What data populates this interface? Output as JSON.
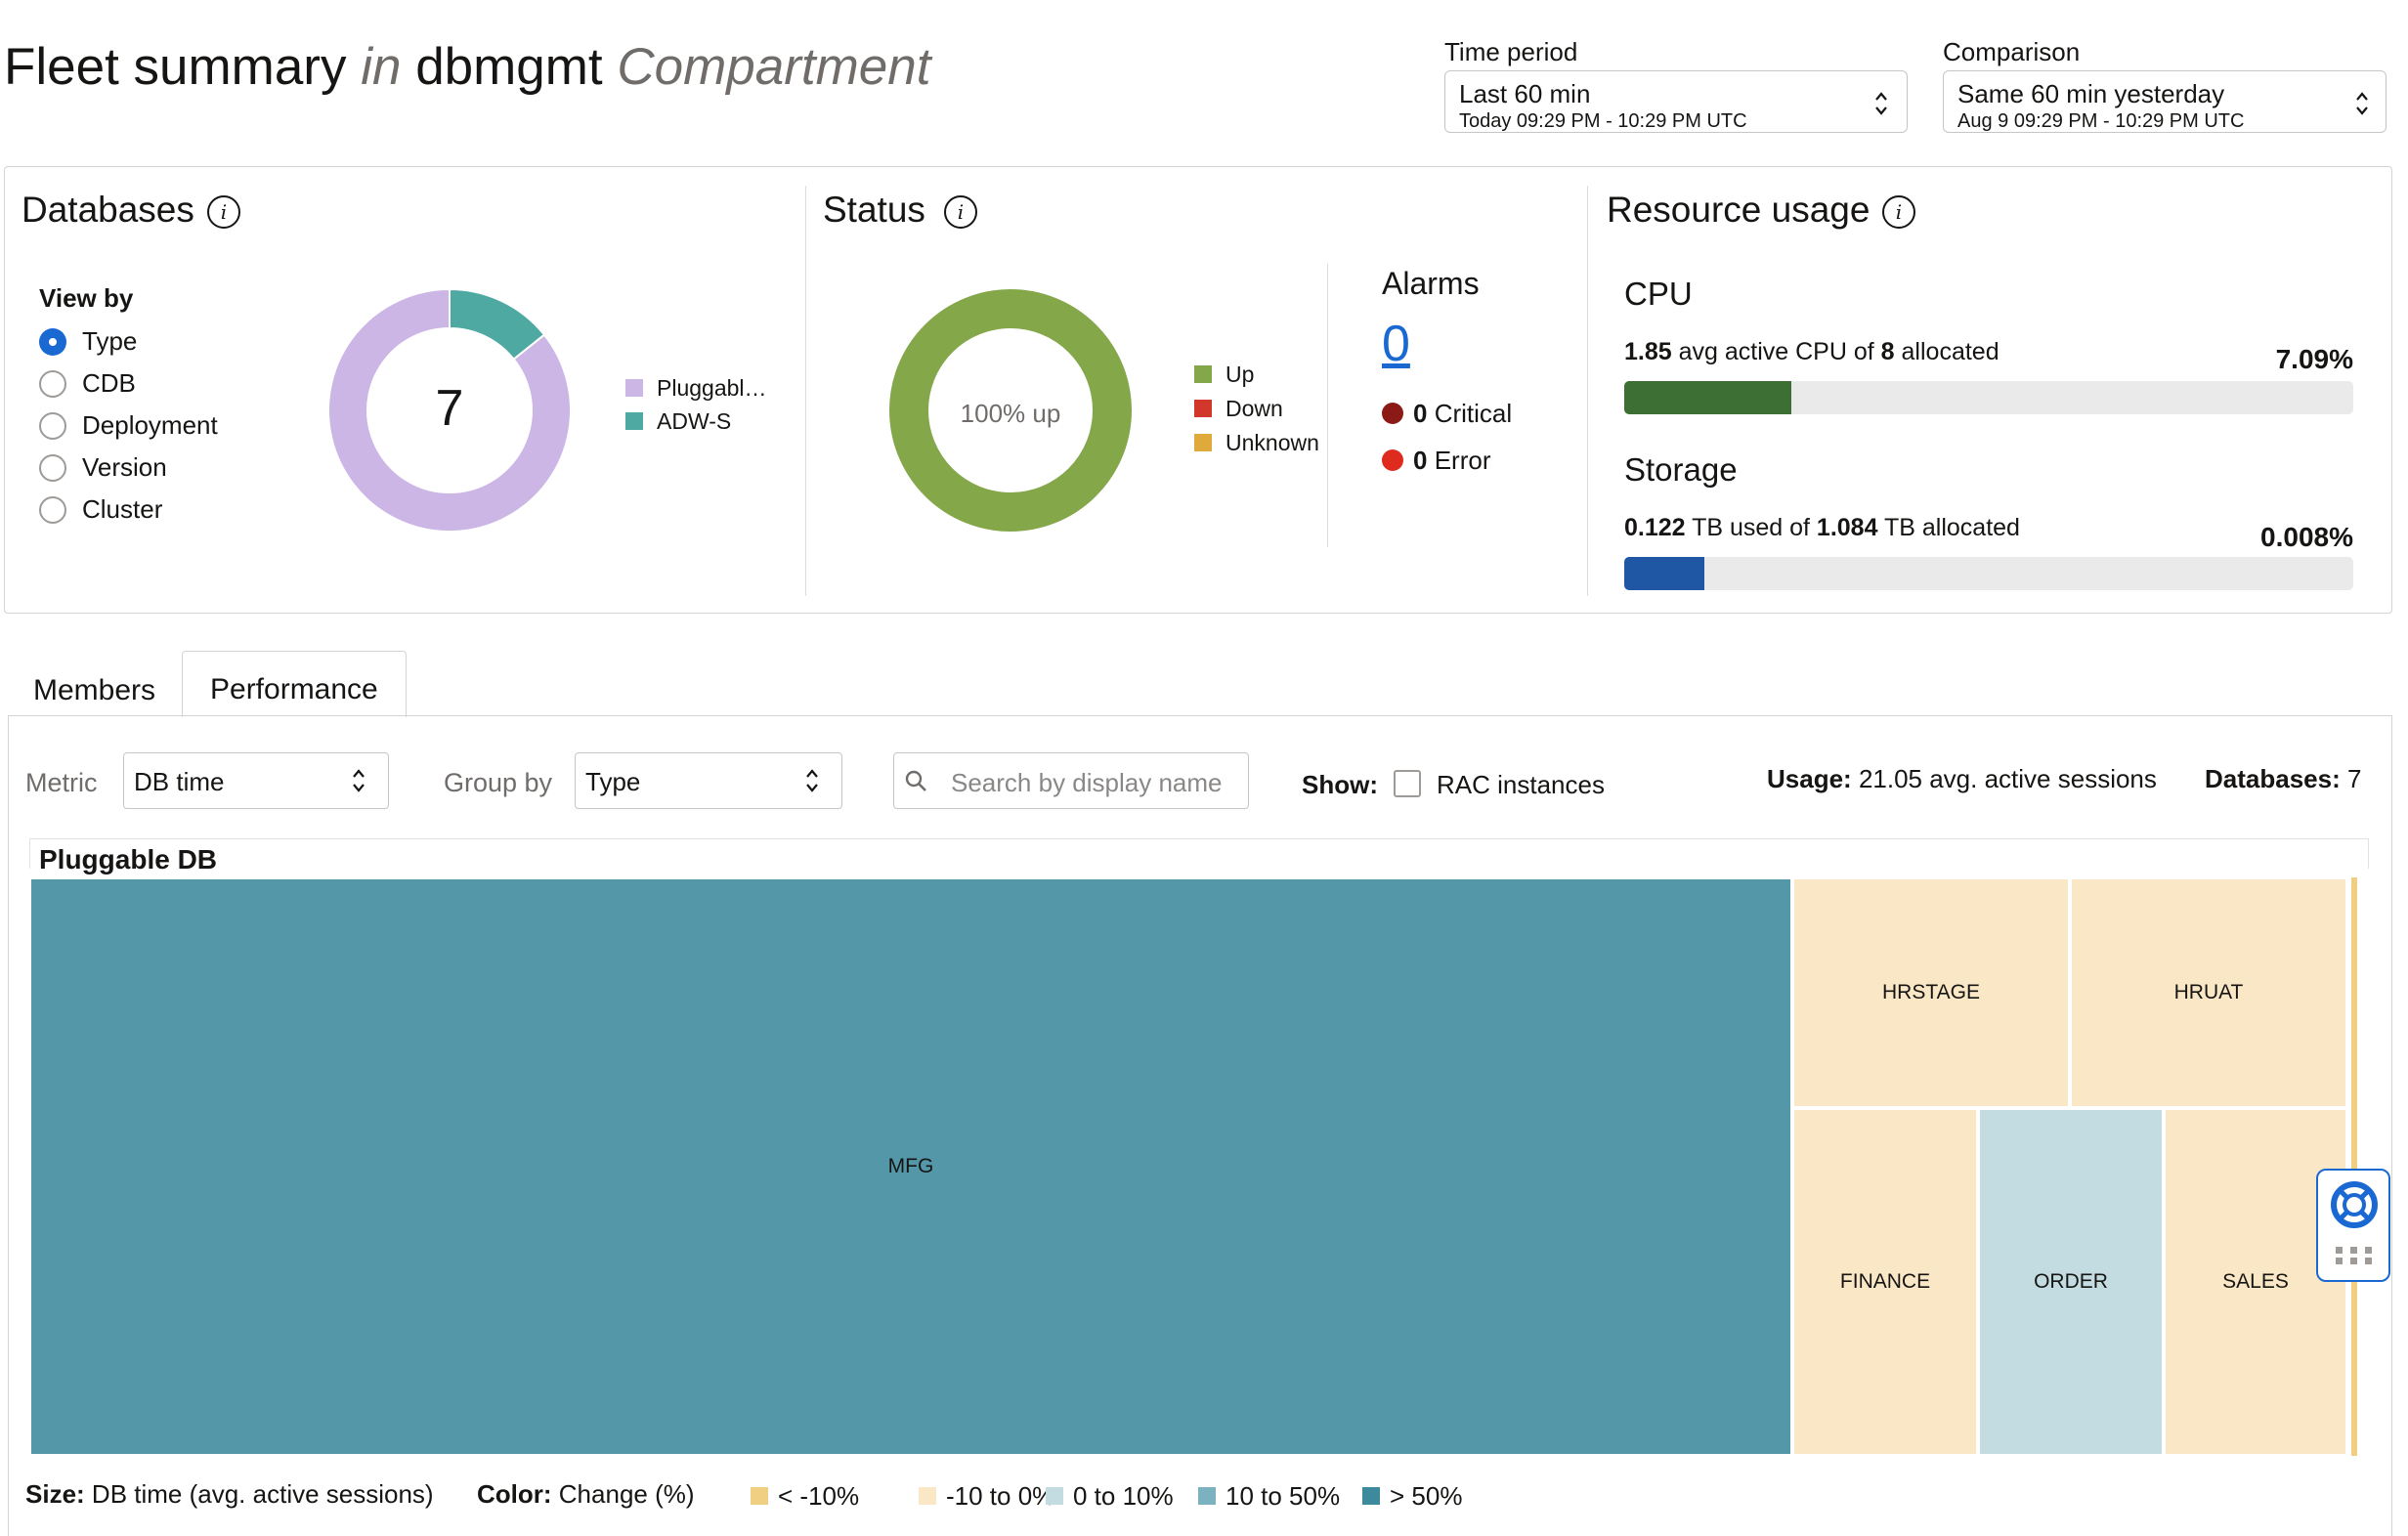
{
  "header": {
    "title_main": "Fleet summary",
    "title_in": "in",
    "title_compartment_name": "dbmgmt",
    "title_compartment_word": "Compartment",
    "time_period": {
      "label": "Time period",
      "value": "Last 60 min",
      "range": "Today 09:29 PM - 10:29 PM UTC"
    },
    "comparison": {
      "label": "Comparison",
      "value": "Same 60 min yesterday",
      "range": "Aug 9 09:29 PM - 10:29 PM UTC"
    }
  },
  "databases": {
    "title": "Databases",
    "view_by_label": "View by",
    "options": [
      "Type",
      "CDB",
      "Deployment",
      "Version",
      "Cluster"
    ],
    "selected": "Type",
    "total": "7",
    "donut": [
      {
        "name": "Pluggabl…",
        "value": 6,
        "color": "#cbb6e6"
      },
      {
        "name": "ADW-S",
        "value": 1,
        "color": "#4fa9a3"
      }
    ]
  },
  "status": {
    "title": "Status",
    "center_text": "100% up",
    "up_fraction": 1.0,
    "legend": [
      {
        "name": "Up",
        "color": "#84a74a"
      },
      {
        "name": "Down",
        "color": "#d2372b"
      },
      {
        "name": "Unknown",
        "color": "#e0a93b"
      }
    ],
    "alarms_title": "Alarms",
    "alarms_count": "0",
    "critical_count": "0",
    "critical_label": "Critical",
    "error_count": "0",
    "error_label": "Error",
    "critical_color": "#8b1a16",
    "error_color": "#de2a1f"
  },
  "resource_usage": {
    "title": "Resource usage",
    "cpu": {
      "title": "CPU",
      "used": "1.85",
      "used_text": "avg active CPU of",
      "allocated": "8",
      "allocated_text": "allocated",
      "percent": "7.09%",
      "fill_fraction": 0.229,
      "color": "#3d6e34"
    },
    "storage": {
      "title": "Storage",
      "used": "0.122",
      "used_text": "TB used of",
      "allocated": "1.084",
      "allocated_text": "TB allocated",
      "percent": "0.008%",
      "fill_fraction": 0.11,
      "color": "#1f57a5"
    }
  },
  "tabs": [
    "Members",
    "Performance"
  ],
  "active_tab": "Performance",
  "toolbar": {
    "metric_label": "Metric",
    "metric_value": "DB time",
    "group_label": "Group by",
    "group_value": "Type",
    "search_placeholder": "Search by display name",
    "show_label": "Show:",
    "rac_label": "RAC instances",
    "usage_label": "Usage:",
    "usage_value": "21.05 avg. active sessions",
    "databases_label": "Databases:",
    "databases_value": "7"
  },
  "treemap": {
    "group_title": "Pluggable DB",
    "cells": [
      {
        "name": "MFG",
        "color": "#5497a8"
      },
      {
        "name": "HRSTAGE",
        "color": "#f9e7c5"
      },
      {
        "name": "HRUAT",
        "color": "#f9e7c5"
      },
      {
        "name": "FINANCE",
        "color": "#f9e7c5"
      },
      {
        "name": "ORDER",
        "color": "#c3dce2"
      },
      {
        "name": "SALES",
        "color": "#f9e7c5"
      }
    ]
  },
  "legend": {
    "size_label": "Size:",
    "size_value": "DB time (avg. active sessions)",
    "color_label": "Color:",
    "color_value": "Change (%)",
    "items": [
      {
        "name": "< -10%",
        "color": "#f0cf83"
      },
      {
        "name": "-10 to 0%",
        "color": "#f9e7c5"
      },
      {
        "name": "0 to 10%",
        "color": "#c3dce2"
      },
      {
        "name": "10 to 50%",
        "color": "#7cb2c0"
      },
      {
        "name": "> 50%",
        "color": "#3d8a9c"
      }
    ]
  }
}
